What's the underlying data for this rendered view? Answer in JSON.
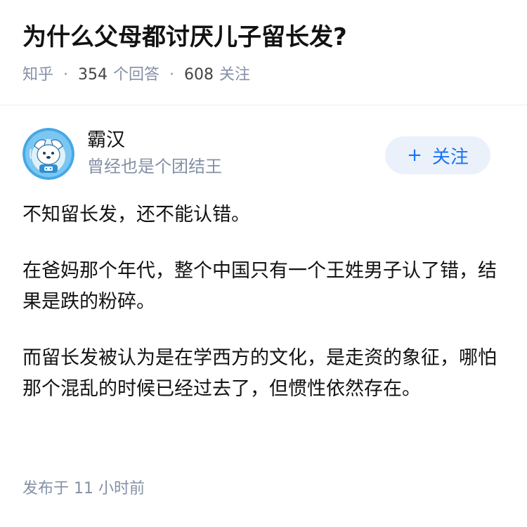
{
  "question": {
    "title": "为什么父母都讨厌儿子留长发?",
    "source": "知乎",
    "separator": "·",
    "answer_count": "354",
    "answer_label": "个回答",
    "follower_count": "608",
    "follower_label": "关注"
  },
  "answer": {
    "author": {
      "name": "霸汉",
      "headline": "曾经也是个团结王",
      "avatar_icon": "dog-astronaut-avatar-icon"
    },
    "follow_button": {
      "icon": "plus-icon",
      "plus": "+",
      "label": "关注"
    },
    "paragraphs": [
      "不知留长发，还不能认错。",
      "在爸妈那个年代，整个中国只有一个王姓男子认了错，结果是跌的粉碎。",
      "而留长发被认为是在学西方的文化，是走资的象征，哪怕那个混乱的时候已经过去了，但惯性依然存在。"
    ],
    "post_time": "发布于  11 小时前"
  },
  "colors": {
    "title": "#121212",
    "meta": "#8590a6",
    "accent": "#1772f6",
    "follow_bg": "#ebf1fb",
    "avatar_blue": "#45a8e6"
  }
}
